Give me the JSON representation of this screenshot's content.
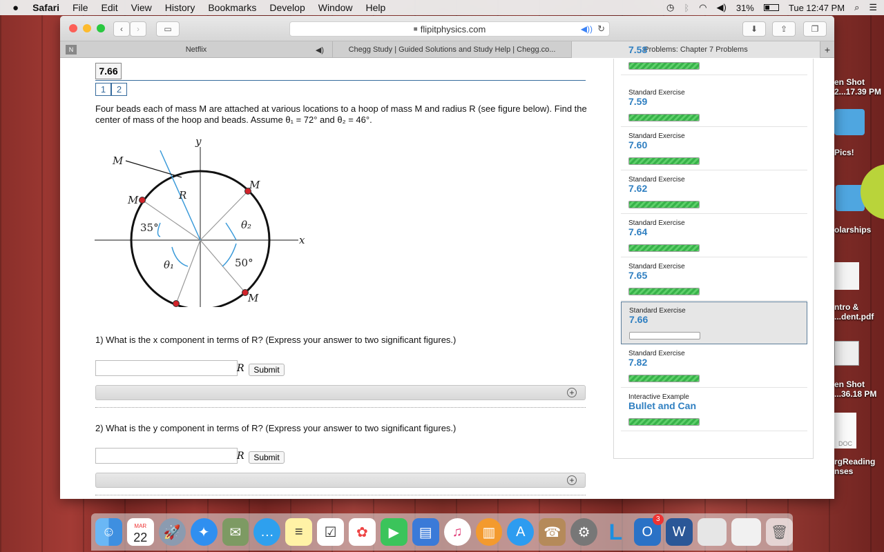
{
  "menubar": {
    "apple": "",
    "app": "Safari",
    "items": [
      "File",
      "Edit",
      "View",
      "History",
      "Bookmarks",
      "Develop",
      "Window",
      "Help"
    ],
    "battery": "31%",
    "clock": "Tue 12:47 PM"
  },
  "browser": {
    "url": "flipitphysics.com",
    "tabs": [
      {
        "label": "Netflix",
        "audio": true
      },
      {
        "label": "Chegg Study | Guided Solutions and Study Help | Chegg.co...",
        "audio": false
      },
      {
        "label": "Problems: Chapter 7 Problems",
        "audio": false
      }
    ],
    "new_tab": "+"
  },
  "problem": {
    "number": "7.66",
    "parts": [
      "1",
      "2"
    ],
    "statement": "Four beads each of mass M are attached at various locations to a hoop of mass M and radius R (see figure below). Find the center of mass of the hoop and beads. Assume θ₁ = 72° and θ₂ = 46°.",
    "figure": {
      "labels": {
        "y": "y",
        "x": "x",
        "R": "R",
        "M": "M",
        "theta1": "θ₁",
        "theta2": "θ₂",
        "a35": "35°",
        "a50": "50°"
      }
    },
    "q1": "1) What is the x component in terms of R? (Express your answer to two significant figures.)",
    "q2": "2) What is the y component in terms of R? (Express your answer to two significant figures.)",
    "unit": "R",
    "submit": "Submit"
  },
  "sidebar": {
    "items": [
      {
        "kind": "",
        "name": "7.58",
        "progress": 1
      },
      {
        "kind": "Standard Exercise",
        "name": "7.59",
        "progress": 1
      },
      {
        "kind": "Standard Exercise",
        "name": "7.60",
        "progress": 1
      },
      {
        "kind": "Standard Exercise",
        "name": "7.62",
        "progress": 1
      },
      {
        "kind": "Standard Exercise",
        "name": "7.64",
        "progress": 1
      },
      {
        "kind": "Standard Exercise",
        "name": "7.65",
        "progress": 1
      },
      {
        "kind": "Standard Exercise",
        "name": "7.66",
        "progress": 0,
        "selected": true
      },
      {
        "kind": "Standard Exercise",
        "name": "7.82",
        "progress": 1
      },
      {
        "kind": "Interactive Example",
        "name": "Bullet and Can",
        "progress": 1
      }
    ]
  },
  "desktop": {
    "icons": [
      "en Shot\n2...17.39 PM",
      "Pics!",
      "olarships",
      "ntro &\n...dent.pdf",
      "en Shot\n...36.18 PM",
      "DOC",
      "rgReading\nnses"
    ]
  },
  "dock": {
    "calendar_month": "MAR",
    "calendar_day": "22",
    "badge_outlook": "3"
  }
}
